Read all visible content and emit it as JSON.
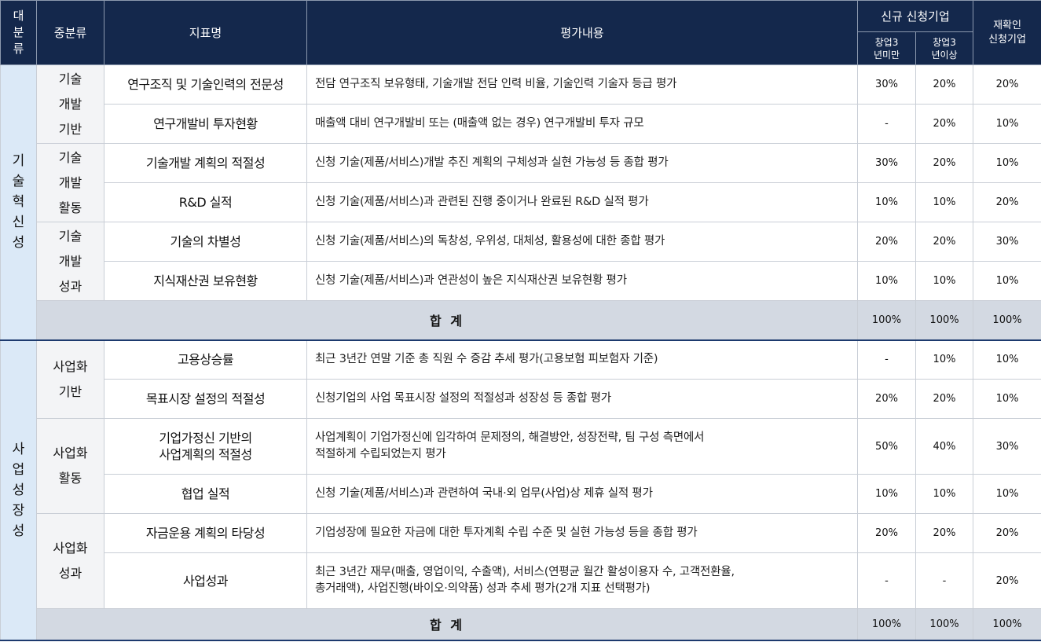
{
  "header": {
    "major": [
      "대",
      "분",
      "류"
    ],
    "mid": "중분류",
    "indicator": "지표명",
    "content": "평가내용",
    "new_applicants": "신규 신청기업",
    "startup_under3": [
      "창업3",
      "년미만"
    ],
    "startup_over3": [
      "창업3",
      "년이상"
    ],
    "reconfirm": [
      "재확인",
      "신청기업"
    ]
  },
  "sections": [
    {
      "category": [
        "기",
        "술",
        "혁",
        "신",
        "성"
      ],
      "groups": [
        {
          "name": [
            "기술",
            "개발",
            "기반"
          ],
          "rows": [
            {
              "indicator": [
                "연구조직 및 기술인력의 전문성"
              ],
              "content": [
                "전담 연구조직 보유형태, 기술개발 전담 인력 비율, 기술인력 기술자 등급 평가"
              ],
              "v1": "30%",
              "v2": "20%",
              "v3": "20%"
            },
            {
              "indicator": [
                "연구개발비 투자현황"
              ],
              "content": [
                "매출액 대비 연구개발비 또는 (매출액 없는 경우) 연구개발비 투자 규모"
              ],
              "v1": "-",
              "v2": "20%",
              "v3": "10%"
            }
          ]
        },
        {
          "name": [
            "기술",
            "개발",
            "활동"
          ],
          "rows": [
            {
              "indicator": [
                "기술개발 계획의 적절성"
              ],
              "content": [
                "신청 기술(제품/서비스)개발 추진 계획의 구체성과 실현 가능성 등 종합 평가"
              ],
              "v1": "30%",
              "v2": "20%",
              "v3": "10%"
            },
            {
              "indicator": [
                "R&D 실적"
              ],
              "content": [
                "신청 기술(제품/서비스)과 관련된 진행 중이거나 완료된 R&D 실적 평가"
              ],
              "v1": "10%",
              "v2": "10%",
              "v3": "20%"
            }
          ]
        },
        {
          "name": [
            "기술",
            "개발",
            "성과"
          ],
          "rows": [
            {
              "indicator": [
                "기술의 차별성"
              ],
              "content": [
                "신청 기술(제품/서비스)의 독창성, 우위성, 대체성, 활용성에 대한 종합 평가"
              ],
              "v1": "20%",
              "v2": "20%",
              "v3": "30%"
            },
            {
              "indicator": [
                "지식재산권 보유현황"
              ],
              "content": [
                "신청 기술(제품/서비스)과 연관성이 높은 지식재산권 보유현황 평가"
              ],
              "v1": "10%",
              "v2": "10%",
              "v3": "10%"
            }
          ]
        }
      ],
      "total": {
        "label": "합 계",
        "v1": "100%",
        "v2": "100%",
        "v3": "100%"
      }
    },
    {
      "category": [
        "사",
        "업",
        "성",
        "장",
        "성"
      ],
      "groups": [
        {
          "name": [
            "사업화",
            "기반"
          ],
          "rows": [
            {
              "indicator": [
                "고용상승률"
              ],
              "content": [
                "최근 3년간 연말 기준 총 직원 수 증감 추세 평가(고용보험 피보험자 기준)"
              ],
              "v1": "-",
              "v2": "10%",
              "v3": "10%"
            },
            {
              "indicator": [
                "목표시장 설정의 적절성"
              ],
              "content": [
                "신청기업의 사업 목표시장 설정의 적절성과 성장성 등 종합 평가"
              ],
              "v1": "20%",
              "v2": "20%",
              "v3": "10%"
            }
          ]
        },
        {
          "name": [
            "사업화",
            "활동"
          ],
          "rows": [
            {
              "indicator": [
                "기업가정신 기반의",
                "사업계획의 적절성"
              ],
              "content": [
                "사업계획이 기업가정신에 입각하여 문제정의, 해결방안, 성장전략, 팀 구성 측면에서",
                "적절하게 수립되었는지 평가"
              ],
              "v1": "50%",
              "v2": "40%",
              "v3": "30%"
            },
            {
              "indicator": [
                "협업 실적"
              ],
              "content": [
                "신청 기술(제품/서비스)과 관련하여 국내·외 업무(사업)상 제휴 실적 평가"
              ],
              "v1": "10%",
              "v2": "10%",
              "v3": "10%"
            }
          ]
        },
        {
          "name": [
            "사업화",
            "성과"
          ],
          "rows": [
            {
              "indicator": [
                "자금운용 계획의 타당성"
              ],
              "content": [
                "기업성장에 필요한 자금에 대한 투자계획 수립 수준 및 실현 가능성 등을 종합 평가"
              ],
              "v1": "20%",
              "v2": "20%",
              "v3": "20%"
            },
            {
              "indicator": [
                "사업성과"
              ],
              "content": [
                "최근 3년간 재무(매출, 영업이익, 수출액), 서비스(연평균 월간 활성이용자 수, 고객전환율,",
                "총거래액), 사업진행(바이오·의약품) 성과 추세 평가(2개 지표 선택평가)"
              ],
              "v1": "-",
              "v2": "-",
              "v3": "20%"
            }
          ]
        }
      ],
      "total": {
        "label": "합 계",
        "v1": "100%",
        "v2": "100%",
        "v3": "100%"
      }
    }
  ]
}
